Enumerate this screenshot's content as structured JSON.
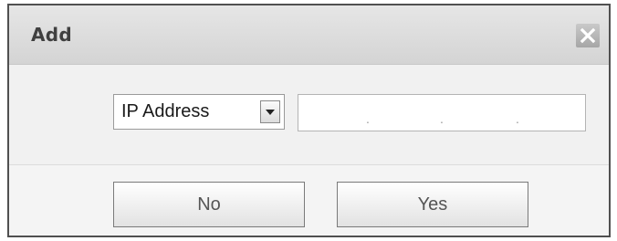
{
  "dialog": {
    "title": "Add",
    "close_icon": "close-x-icon"
  },
  "form": {
    "type_select": {
      "value": "IP Address",
      "arrow_icon": "chevron-down-icon"
    },
    "address_input": {
      "value": "",
      "separators": [
        ".",
        ".",
        "."
      ]
    }
  },
  "footer": {
    "no_label": "No",
    "yes_label": "Yes"
  }
}
